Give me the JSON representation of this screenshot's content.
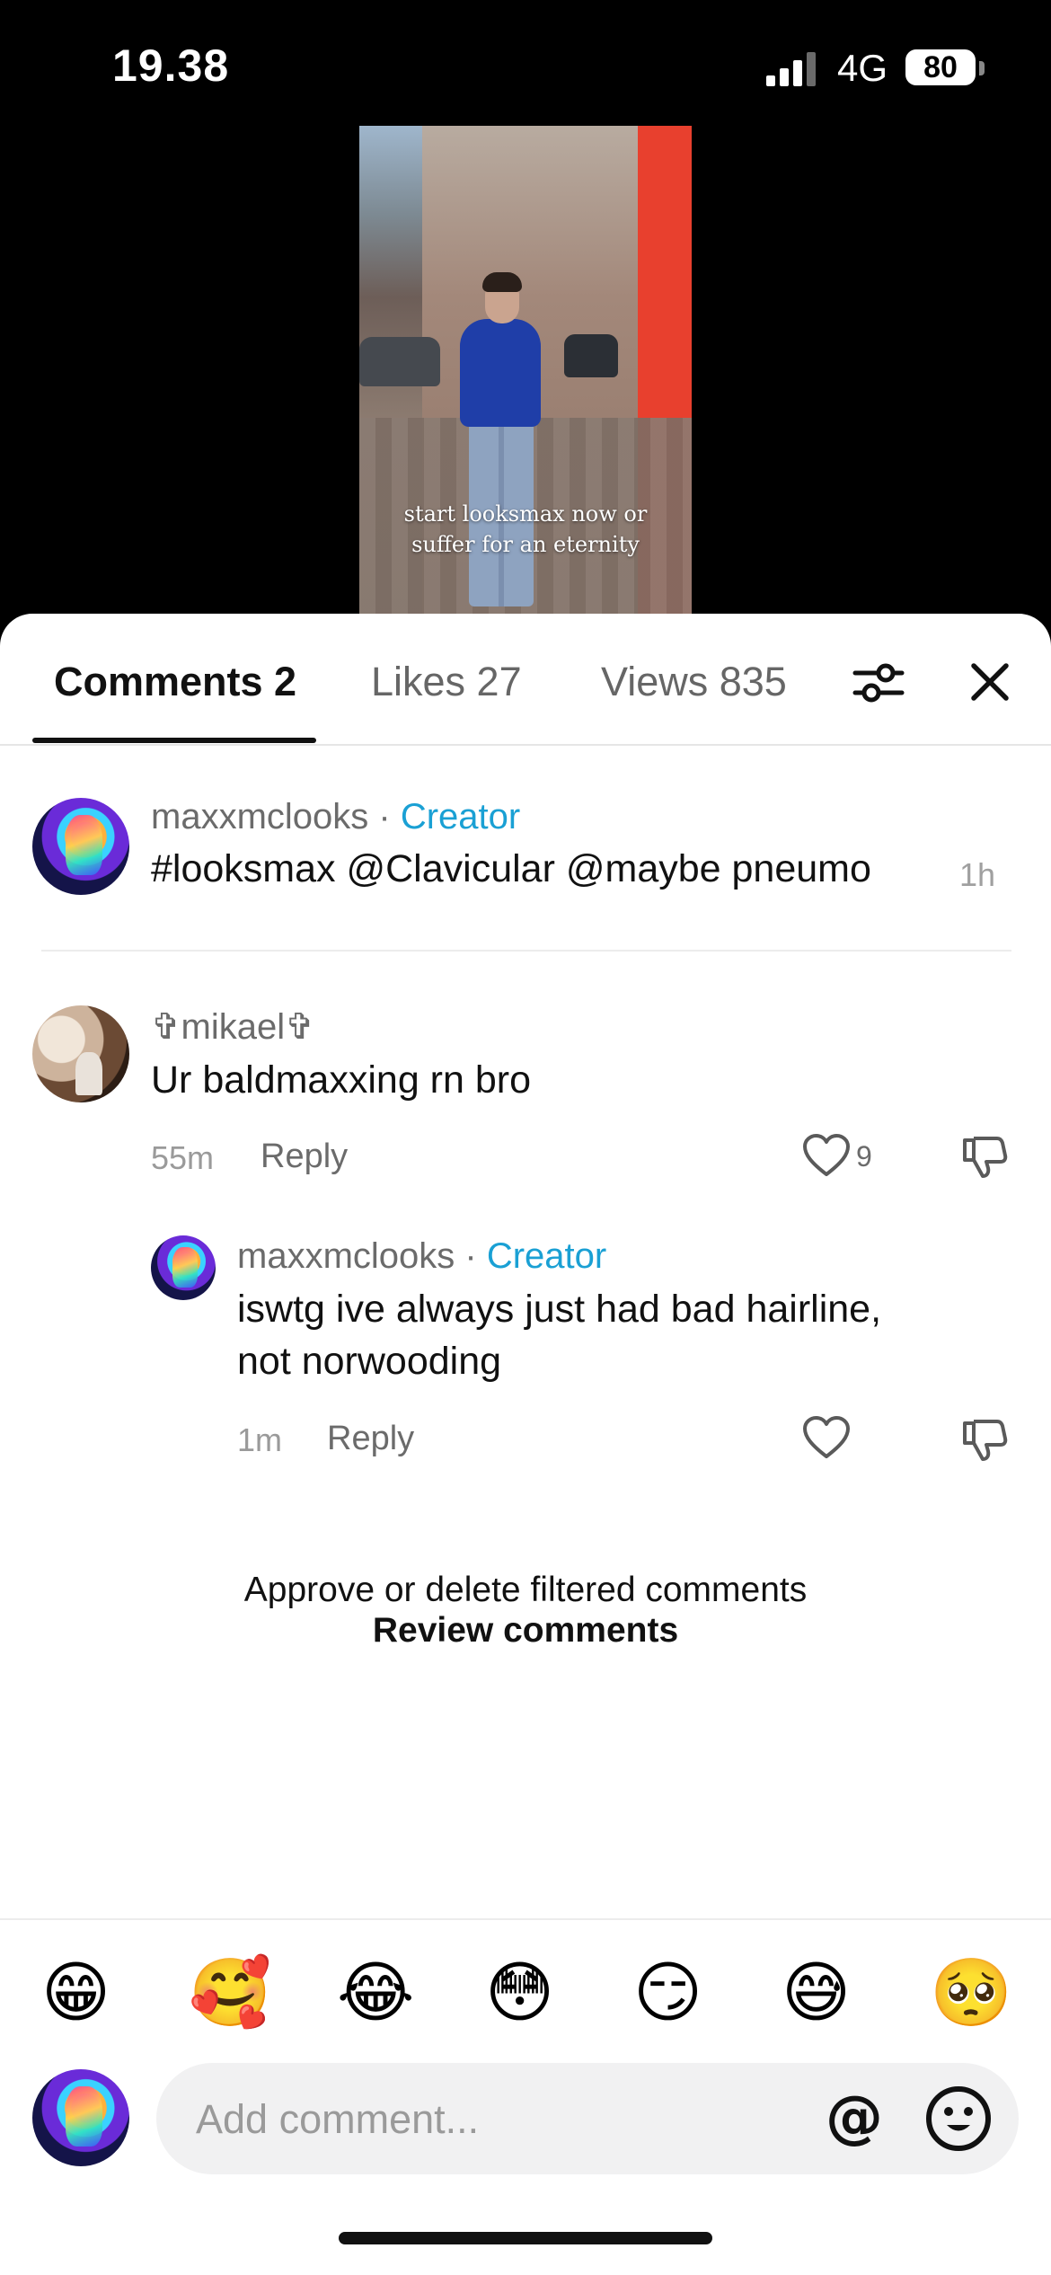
{
  "status_bar": {
    "time": "19.38",
    "network": "4G",
    "battery": "80"
  },
  "video": {
    "caption_line1": "start looksmax now or",
    "caption_line2": "suffer for an eternity"
  },
  "tabs": [
    {
      "label": "Comments 2",
      "active": true
    },
    {
      "label": "Likes 27",
      "active": false
    },
    {
      "label": "Views 835",
      "active": false
    }
  ],
  "caption_comment": {
    "username": "maxxmclooks",
    "separator": "·",
    "badge": "Creator",
    "text": "#looksmax @Clavicular @maybe pneumo",
    "time": "1h"
  },
  "comments": [
    {
      "username": "✞mikael✞",
      "text": "Ur baldmaxxing rn bro",
      "time": "55m",
      "reply_label": "Reply",
      "likes": "9"
    }
  ],
  "replies": [
    {
      "username": "maxxmclooks",
      "separator": "·",
      "badge": "Creator",
      "text_line1": "iswtg ive always just had bad hairline,",
      "text_line2": "not norwooding",
      "time": "1m",
      "reply_label": "Reply"
    }
  ],
  "filtered": {
    "message": "Approve or delete filtered comments",
    "action": "Review comments"
  },
  "emojis": [
    "😁",
    "🥰",
    "😂",
    "😳",
    "😏",
    "😅",
    "🥺"
  ],
  "composer": {
    "placeholder": "Add comment...",
    "at_symbol": "@"
  },
  "colors": {
    "accent_creator": "#1aa0d4",
    "text_primary": "#111111",
    "text_secondary": "#6b6b6b"
  }
}
